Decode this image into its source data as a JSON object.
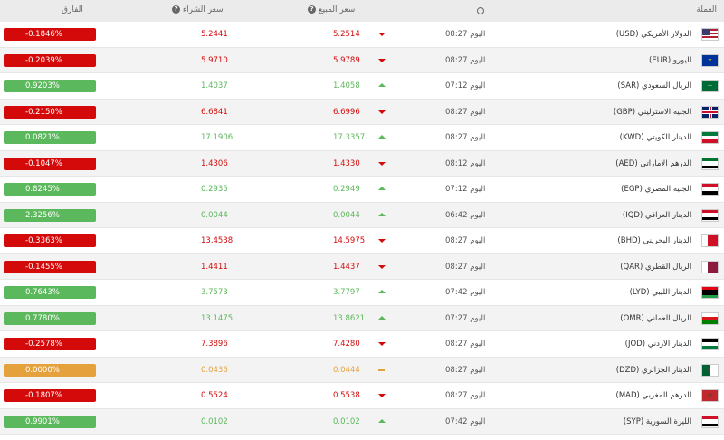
{
  "header": {
    "diff": "الفارق",
    "buy": "سعر الشراء",
    "sell": "سعر المبيع",
    "currency": "العملة",
    "help": "?"
  },
  "rows": [
    {
      "diff": "-0.1846%",
      "buy": "5.2441",
      "sell": "5.2514",
      "dir": "down",
      "time": "اليوم 08:27",
      "name": "الدولار الأمريكي (USD)",
      "flag": "usd"
    },
    {
      "diff": "-0.2039%",
      "buy": "5.9710",
      "sell": "5.9789",
      "dir": "down",
      "time": "اليوم 08:27",
      "name": "اليورو (EUR)",
      "flag": "eur"
    },
    {
      "diff": "0.9203%",
      "buy": "1.4037",
      "sell": "1.4058",
      "dir": "up",
      "time": "اليوم 07:12",
      "name": "الريال السعودي (SAR)",
      "flag": "sar"
    },
    {
      "diff": "-0.2150%",
      "buy": "6.6841",
      "sell": "6.6996",
      "dir": "down",
      "time": "اليوم 08:27",
      "name": "الجنيه الاسترليني (GBP)",
      "flag": "gbp"
    },
    {
      "diff": "0.0821%",
      "buy": "17.1906",
      "sell": "17.3357",
      "dir": "up",
      "time": "اليوم 08:27",
      "name": "الدينار الكويتي (KWD)",
      "flag": "kwd"
    },
    {
      "diff": "-0.1047%",
      "buy": "1.4306",
      "sell": "1.4330",
      "dir": "down",
      "time": "اليوم 08:12",
      "name": "الدرهم الاماراتي (AED)",
      "flag": "aed"
    },
    {
      "diff": "0.8245%",
      "buy": "0.2935",
      "sell": "0.2949",
      "dir": "up",
      "time": "اليوم 07:12",
      "name": "الجنيه المصري (EGP)",
      "flag": "egp"
    },
    {
      "diff": "2.3256%",
      "buy": "0.0044",
      "sell": "0.0044",
      "dir": "up",
      "time": "اليوم 06:42",
      "name": "الدينار العراقي (IQD)",
      "flag": "iqd"
    },
    {
      "diff": "-0.3363%",
      "buy": "13.4538",
      "sell": "14.5975",
      "dir": "down",
      "time": "اليوم 08:27",
      "name": "الدينار البحريني (BHD)",
      "flag": "bhd"
    },
    {
      "diff": "-0.1455%",
      "buy": "1.4411",
      "sell": "1.4437",
      "dir": "down",
      "time": "اليوم 08:27",
      "name": "الريال القطري (QAR)",
      "flag": "qar"
    },
    {
      "diff": "0.7643%",
      "buy": "3.7573",
      "sell": "3.7797",
      "dir": "up",
      "time": "اليوم 07:42",
      "name": "الدينار الليبي (LYD)",
      "flag": "lyd"
    },
    {
      "diff": "0.7780%",
      "buy": "13.1475",
      "sell": "13.8621",
      "dir": "up",
      "time": "اليوم 07:27",
      "name": "الريال العماني (OMR)",
      "flag": "omr"
    },
    {
      "diff": "-0.2578%",
      "buy": "7.3896",
      "sell": "7.4280",
      "dir": "down",
      "time": "اليوم 08:27",
      "name": "الدينار الاردني (JOD)",
      "flag": "jod"
    },
    {
      "diff": "0.0000%",
      "buy": "0.0436",
      "sell": "0.0444",
      "dir": "flat",
      "time": "اليوم 08:27",
      "name": "الدينار الجزائري (DZD)",
      "flag": "dzd"
    },
    {
      "diff": "-0.1807%",
      "buy": "0.5524",
      "sell": "0.5538",
      "dir": "down",
      "time": "اليوم 08:27",
      "name": "الدرهم المغربي (MAD)",
      "flag": "mad"
    },
    {
      "diff": "0.9901%",
      "buy": "0.0102",
      "sell": "0.0102",
      "dir": "up",
      "time": "اليوم 07:42",
      "name": "الليرة السورية (SYP)",
      "flag": "syp"
    }
  ],
  "colors": {
    "down": "#d40a0a",
    "up": "#5cb85c",
    "flat": "#e5a23c",
    "header_bg": "#ebebeb",
    "alt_bg": "#f3f3f3"
  }
}
